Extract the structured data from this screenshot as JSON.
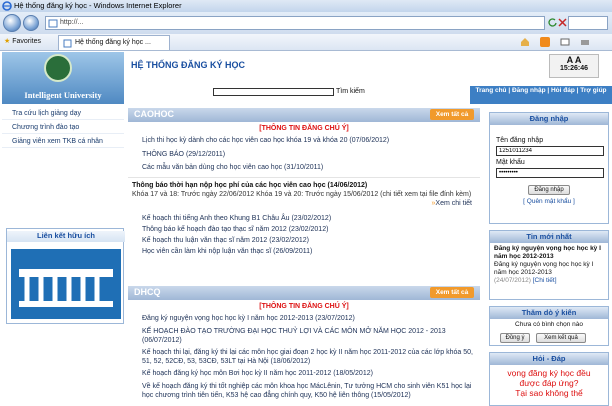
{
  "browser": {
    "title": "Hệ thống đăng ký học  -  Windows Internet Explorer",
    "url": "http://...",
    "favorites_label": "Favorites",
    "tab_label": "Hệ thống đăng ký học ..."
  },
  "header": {
    "logo_text": "Intelligent University",
    "site_title": "HỆ THỐNG ĐĂNG KÝ HỌC",
    "search_label": "Tìm kiếm",
    "clock_letters": "A  A",
    "clock_time": "15:26:46",
    "nav": "Trang chủ | Đăng nhập | Hỏi đáp | Trợ giúp"
  },
  "sidebar": {
    "items": [
      {
        "label": "Tra cứu lịch giảng dạy"
      },
      {
        "label": "Chương trình đào tạo"
      },
      {
        "label": "Giảng viên xem TKB cá nhân"
      }
    ],
    "links_title": "Liên kết hữu ích"
  },
  "cao_hoc": {
    "title": "CAOHOC",
    "more": "Xem tất cả",
    "notice": "[THÔNG TIN ĐĂNG CHÚ Ý]",
    "items": [
      "Lịch thi học kỳ dành cho các học viên cao học khóa 19 và khóa 20 (07/06/2012)",
      "THÔNG BÁO (29/12/2011)",
      "Các mẫu văn bản dùng cho học viên cao học (31/10/2011)"
    ],
    "featured_title": "Thông báo thời hạn nộp học phí của các học viên cao học (14/06/2012)",
    "featured_body": "Khóa 17 và 18: Trước ngày 22/06/2012 Khóa 19 và 20: Trước ngày 15/06/2012 (chi tiết xem tại file đính kèm)",
    "featured_more": "Xem chi tiết",
    "items2": [
      "Kế hoạch thi tiếng Anh theo Khung B1 Châu Âu (23/02/2012)",
      "Thông báo kế hoạch đào tạo thạc sĩ năm 2012 (23/02/2012)",
      "Kế hoạch thu luận văn thạc sĩ năm 2012 (23/02/2012)",
      "Học viên cần làm khi nộp luận văn thạc sĩ (26/09/2011)"
    ]
  },
  "dhcq": {
    "title": "DHCQ",
    "more": "Xem tất cả",
    "notice": "[THÔNG TIN ĐĂNG CHÚ Ý]",
    "items": [
      "Đăng ký nguyện vọng học học kỳ I năm học 2012-2013 (23/07/2012)",
      "KẾ HOẠCH ĐÀO TẠO TRƯỜNG ĐẠI HỌC THUỶ LỢI VÀ CÁC MÔN MỞ NĂM HỌC 2012 - 2013 (06/07/2012)",
      "Kế hoạch thi lại, đăng ký thi lại các môn học giai đoạn 2 học kỳ II năm học 2011-2012 của các lớp khóa 50, 51, 52, 52CĐ, 53, 53CĐ, 53LT tại Hà Nội (18/06/2012)",
      "Kế hoạch đăng ký học môn Bơi học kỳ II năm học 2011-2012 (18/05/2012)",
      "Về kế hoạch đăng ký thi tốt nghiệp các môn khoa học MácLênin, Tư tưởng HCM cho sinh viên K51 học lại học chương trình tiên tiến, K53 hệ cao đẳng chính quy, K50 hệ liên thông (15/05/2012)"
    ]
  },
  "login": {
    "title": "Đăng nhập",
    "user_label": "Tên đăng nhập",
    "user_value": "1251011234",
    "pass_label": "Mật khẩu",
    "pass_value": "•••••••••",
    "submit": "Đăng nhập",
    "forgot": "[ Quên mật khẩu ]"
  },
  "news": {
    "title": "Tin mới nhất",
    "headline": "Đăng ký nguyện vọng học học kỳ I năm học 2012-2013",
    "body": "Đăng ký nguyện vọng học học kỳ I năm học 2012-2013",
    "date": "(24/07/2012)",
    "detail": "[Chi tiết]"
  },
  "poll": {
    "title": "Thăm dò ý kiến",
    "text": "Chưa có bình chọn nào",
    "agree": "Đồng ý",
    "results": "Xem kết quả"
  },
  "qa": {
    "title": "Hỏi - Đáp",
    "marquee1": "vọng đăng ký học đều",
    "marquee2": "được đáp ứng?",
    "marquee3": "Tại sao không thể"
  },
  "colors": {
    "accent": "#1a4fa0",
    "orange": "#f19a2c",
    "notice_red": "#d11111"
  }
}
